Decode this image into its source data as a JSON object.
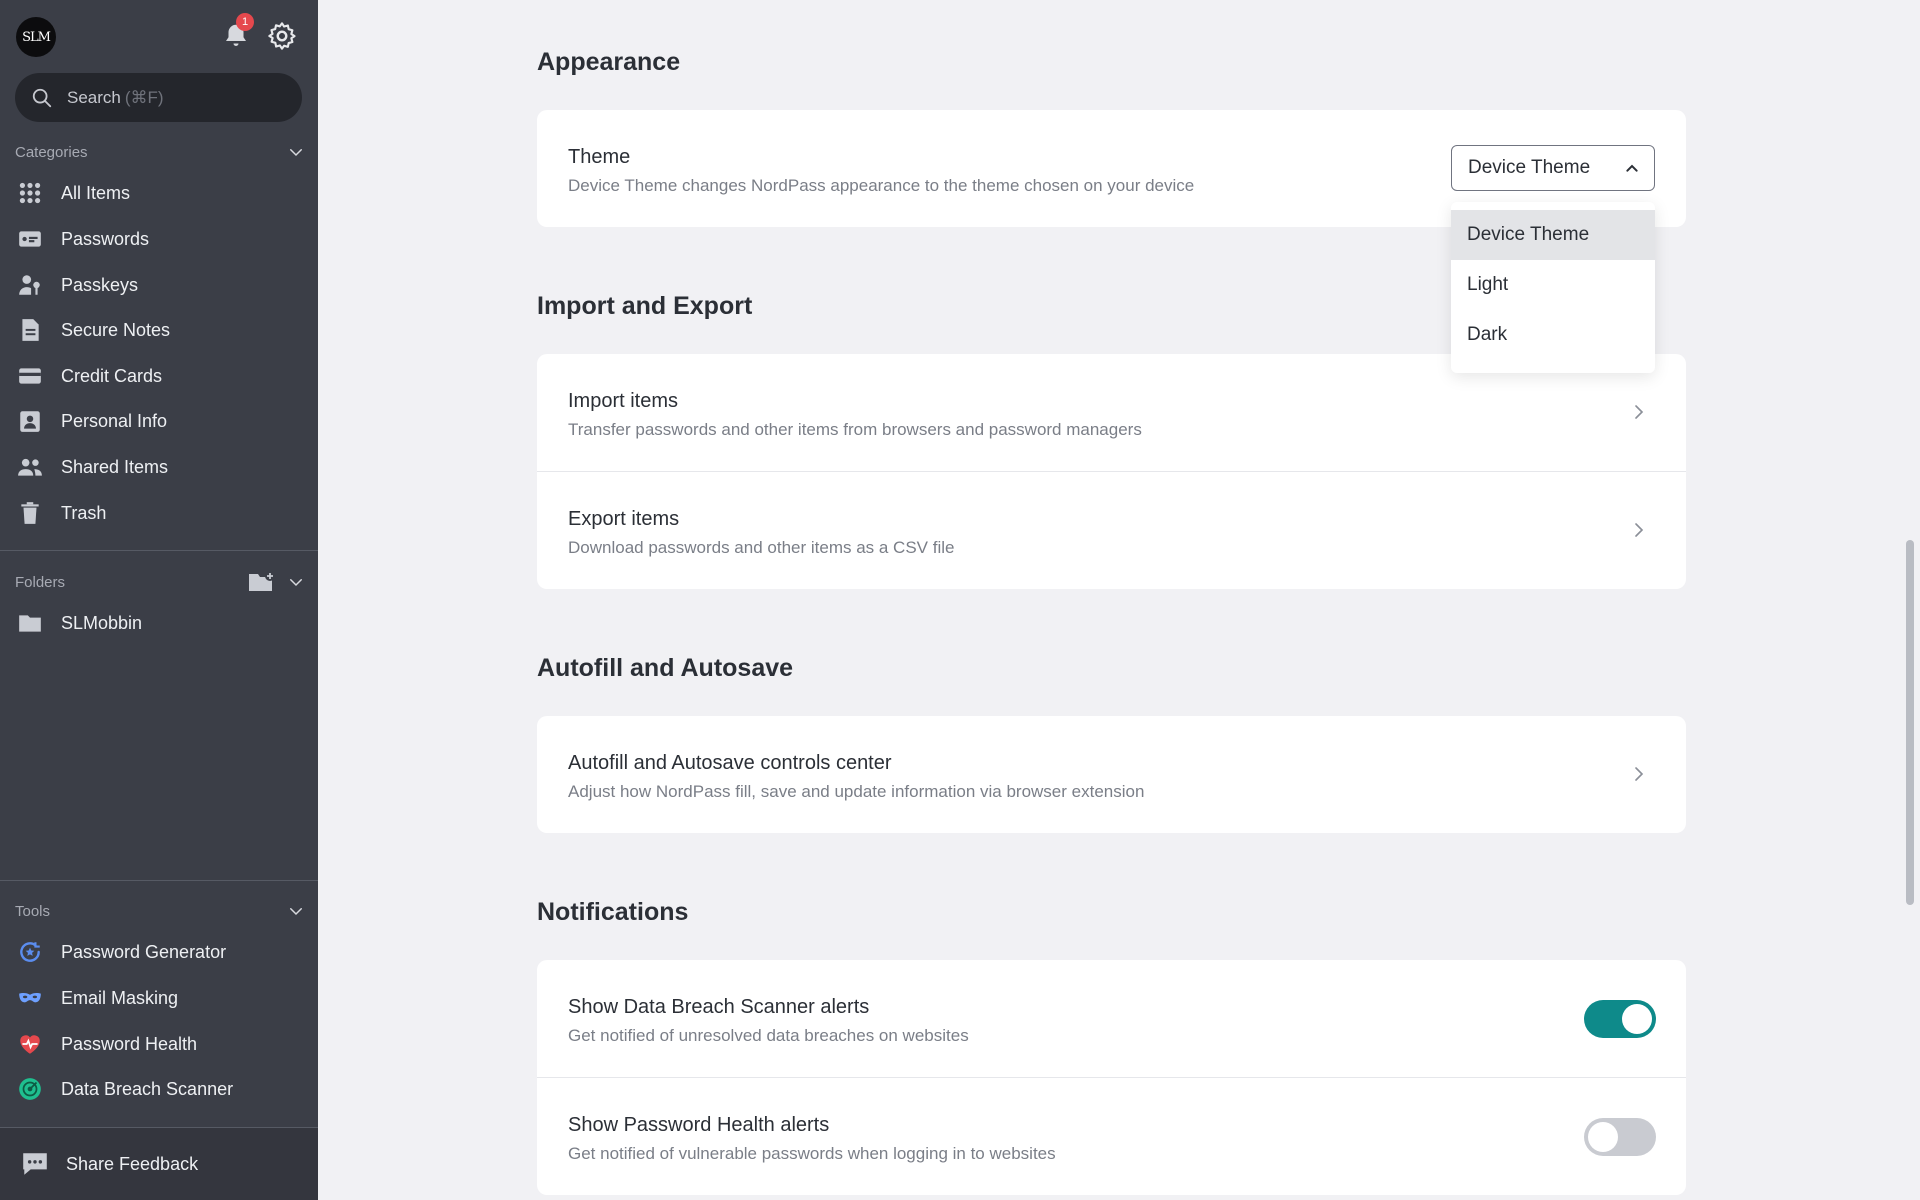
{
  "sidebar": {
    "avatar_text": "SLM",
    "notification_count": "1",
    "search": {
      "label": "Search",
      "shortcut": "(⌘F)"
    },
    "categories": {
      "heading": "Categories",
      "items": [
        {
          "label": "All Items",
          "icon": "grid-icon"
        },
        {
          "label": "Passwords",
          "icon": "password-icon"
        },
        {
          "label": "Passkeys",
          "icon": "passkey-icon"
        },
        {
          "label": "Secure Notes",
          "icon": "note-icon"
        },
        {
          "label": "Credit Cards",
          "icon": "credit-card-icon"
        },
        {
          "label": "Personal Info",
          "icon": "personal-info-icon"
        },
        {
          "label": "Shared Items",
          "icon": "users-icon"
        },
        {
          "label": "Trash",
          "icon": "trash-icon"
        }
      ]
    },
    "folders": {
      "heading": "Folders",
      "items": [
        {
          "label": "SLMobbin",
          "icon": "folder-icon"
        }
      ]
    },
    "tools": {
      "heading": "Tools",
      "items": [
        {
          "label": "Password Generator",
          "icon": "password-generator-icon",
          "color": "#5b8def"
        },
        {
          "label": "Email Masking",
          "icon": "mask-icon",
          "color": "#6ea0ff"
        },
        {
          "label": "Password Health",
          "icon": "heart-pulse-icon",
          "color": "#e5484d"
        },
        {
          "label": "Data Breach Scanner",
          "icon": "radar-icon",
          "color": "#1fbf8f"
        }
      ]
    },
    "feedback_label": "Share Feedback"
  },
  "appearance": {
    "heading": "Appearance",
    "theme": {
      "title": "Theme",
      "description": "Device Theme changes NordPass appearance to the theme chosen on your device",
      "selected": "Device Theme",
      "options": [
        "Device Theme",
        "Light",
        "Dark"
      ]
    }
  },
  "import_export": {
    "heading": "Import and Export",
    "rows": [
      {
        "title": "Import items",
        "description": "Transfer passwords and other items from browsers and password managers"
      },
      {
        "title": "Export items",
        "description": "Download passwords and other items as a CSV file"
      }
    ]
  },
  "autofill": {
    "heading": "Autofill and Autosave",
    "rows": [
      {
        "title": "Autofill and Autosave controls center",
        "description": "Adjust how NordPass fill, save and update information via browser extension"
      }
    ]
  },
  "notifications": {
    "heading": "Notifications",
    "rows": [
      {
        "title": "Show Data Breach Scanner alerts",
        "description": "Get notified of unresolved data breaches on websites",
        "enabled": true
      },
      {
        "title": "Show Password Health alerts",
        "description": "Get notified of vulnerable passwords when logging in to websites",
        "enabled": false
      }
    ]
  },
  "colors": {
    "accent": "#0e8a8a",
    "sidebar_bg": "#3b3e47",
    "badge": "#e5484d"
  }
}
